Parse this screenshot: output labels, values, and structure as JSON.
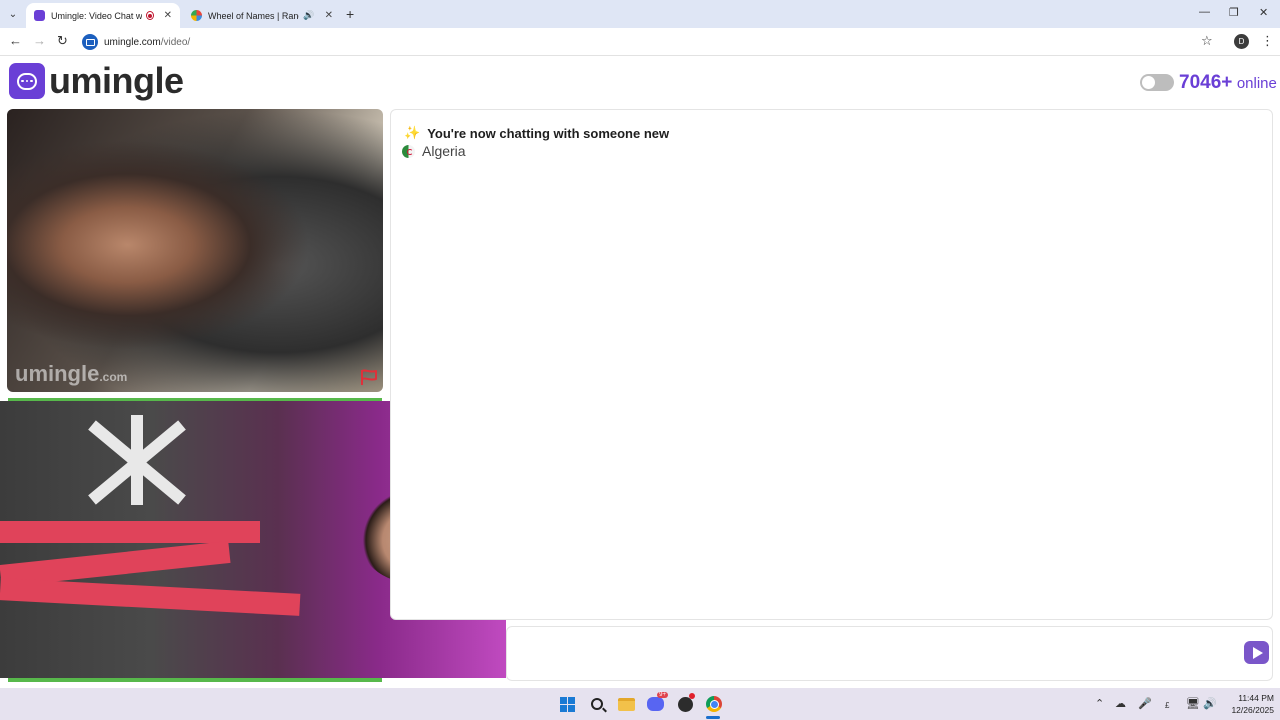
{
  "browser": {
    "tabs": [
      {
        "title": "Umingle: Video Chat with S",
        "active": true,
        "favicon_color": "#6a3fd6"
      },
      {
        "title": "Wheel of Names | Random",
        "active": false,
        "favicon_color": "#e8473b"
      }
    ],
    "new_tab_symbol": "+",
    "url_host": "umingle.com",
    "url_path": "/video/",
    "profile_initial": "D"
  },
  "site": {
    "logo_text": "umingle",
    "online_count": "7046+",
    "online_label": "online",
    "brand_color": "#6a3fd6"
  },
  "video": {
    "watermark": "umingle",
    "watermark_suffix": ".com",
    "report_icon": "flag-icon"
  },
  "chat": {
    "status_message": "You're now chatting with someone new",
    "country": "Algeria",
    "message_placeholder": "",
    "send_icon": "send-icon"
  },
  "taskbar": {
    "discord_badge": "9+",
    "clock_time": "11:44 PM",
    "clock_date": "12/26/2025"
  }
}
